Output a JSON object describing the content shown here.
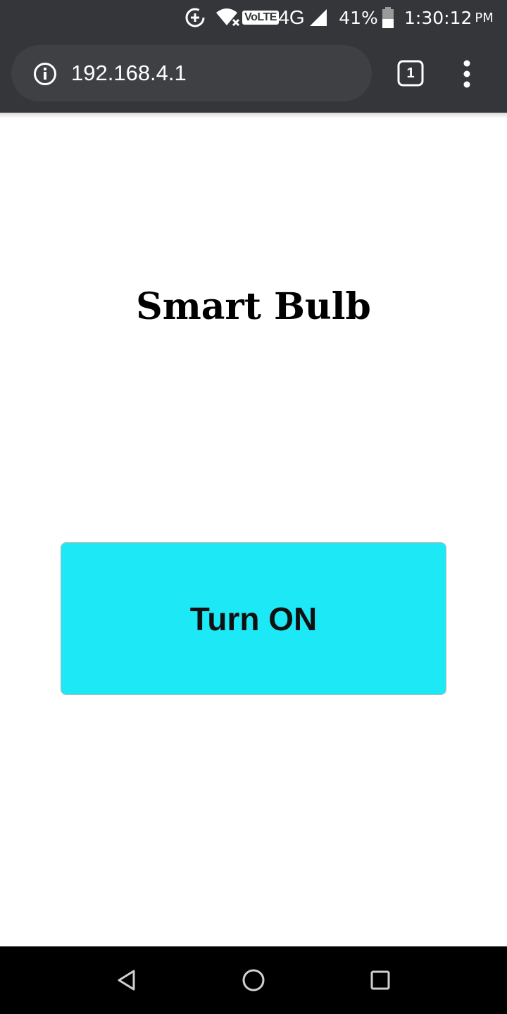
{
  "status_bar": {
    "network_type": "4G",
    "volte_label": "VoLTE",
    "battery_percent": "41%",
    "time": "1:30:12",
    "am_pm": "PM",
    "icons": [
      "data-saver-icon",
      "wifi-no-internet-icon",
      "volte-icon",
      "signal-icon",
      "battery-icon"
    ]
  },
  "browser": {
    "url": "192.168.4.1",
    "tab_count": "1",
    "icons": [
      "info-icon",
      "tab-switcher-icon",
      "more-vert-icon"
    ]
  },
  "page": {
    "title": "Smart Bulb",
    "button_label": "Turn ON",
    "button_color": "#1de9f6"
  },
  "nav_bar": {
    "icons": [
      "back-icon",
      "home-icon",
      "recents-icon"
    ]
  },
  "colors": {
    "chrome_background": "#35363a",
    "url_pill_background": "#3e4044",
    "nav_background": "#000000"
  }
}
